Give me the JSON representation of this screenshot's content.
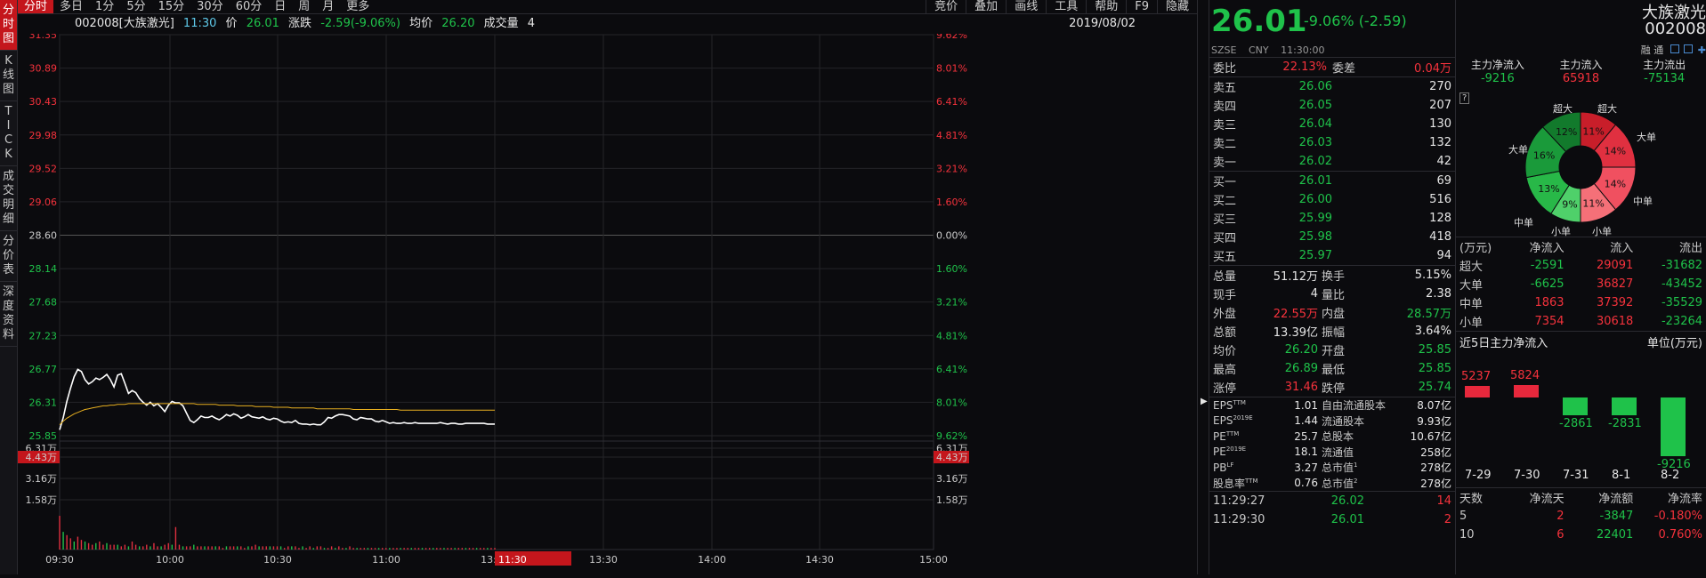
{
  "vtabs": [
    "分时图",
    "K线图",
    "TICK",
    "成交明细",
    "分价表",
    "深度资料"
  ],
  "topbar": {
    "left": [
      "分时",
      "多日",
      "1分",
      "5分",
      "15分",
      "30分",
      "60分",
      "日",
      "周",
      "月",
      "更多"
    ],
    "right": [
      "竞价",
      "叠加",
      "画线",
      "工具",
      "帮助",
      "F9",
      "隐藏"
    ]
  },
  "info": {
    "stock": "002008[大族激光]",
    "time": "11:30",
    "price_label": "价",
    "price": "26.01",
    "chg_label": "涨跌",
    "chg": "-2.59(-9.06%)",
    "avg_label": "均价",
    "avg": "26.20",
    "vol_label": "成交量",
    "vol": "4",
    "date": "2019/08/02"
  },
  "chart_data": {
    "type": "line",
    "title": "",
    "prev_close": 28.6,
    "ylim": [
      25.85,
      31.35
    ],
    "y_ticks_left": [
      "31.35",
      "30.89",
      "30.43",
      "29.98",
      "29.52",
      "29.06",
      "28.60",
      "28.14",
      "27.68",
      "27.23",
      "26.77",
      "26.31",
      "25.85"
    ],
    "y_ticks_right": [
      "9.62%",
      "8.01%",
      "6.41%",
      "4.81%",
      "3.21%",
      "1.60%",
      "0.00%",
      "1.60%",
      "3.21%",
      "4.81%",
      "6.41%",
      "8.01%",
      "9.62%"
    ],
    "x_ticks": [
      "09:30",
      "10:00",
      "10:30",
      "11:00",
      "13:00",
      "13:30",
      "14:00",
      "14:30",
      "15:00"
    ],
    "cursor_time": "11:30",
    "vol_ticks": [
      "6.31万",
      "4.43万",
      "3.16万",
      "1.58万"
    ],
    "vol_cursor": "4.43万",
    "series": [
      {
        "values": [
          25.93,
          26.1,
          26.32,
          26.5,
          26.66,
          26.76,
          26.73,
          26.62,
          26.56,
          26.59,
          26.64,
          26.62,
          26.65,
          26.69,
          26.62,
          26.52,
          26.68,
          26.7,
          26.57,
          26.43,
          26.47,
          26.44,
          26.36,
          26.31,
          26.27,
          26.31,
          26.26,
          26.29,
          26.24,
          26.18,
          26.27,
          26.32,
          26.3,
          26.3,
          26.26,
          26.16,
          26.06,
          26.03,
          26.07,
          26.12,
          26.1,
          26.1,
          26.12,
          26.09,
          26.07,
          26.1,
          26.14,
          26.12,
          26.15,
          26.13,
          26.09,
          26.11,
          26.14,
          26.11,
          26.1,
          26.09,
          26.11,
          26.08,
          26.07,
          26.09,
          26.08,
          26.05,
          26.03,
          26.04,
          26.03,
          26.06,
          26.02,
          26.01,
          26.01,
          26.0,
          26.01,
          26.0,
          26.0,
          26.04,
          26.1,
          26.09,
          26.12,
          26.14,
          26.14,
          26.13,
          26.12,
          26.08,
          26.07,
          26.1,
          26.09,
          26.08,
          26.08,
          26.05,
          26.04,
          26.06,
          26.04,
          26.02,
          26.03,
          26.02,
          26.02,
          26.03,
          26.02,
          26.02,
          26.03,
          26.02,
          26.02,
          26.02,
          26.02,
          26.02,
          26.02,
          26.03,
          26.02,
          26.01,
          26.02,
          26.02,
          26.01,
          26.01,
          26.02,
          26.02,
          26.02,
          26.02,
          26.02,
          26.02,
          26.01,
          26.01,
          26.01
        ]
      },
      {
        "values": [
          26.0,
          26.05,
          26.09,
          26.12,
          26.15,
          26.17,
          26.19,
          26.21,
          26.22,
          26.23,
          26.24,
          26.25,
          26.26,
          26.26,
          26.27,
          26.27,
          26.28,
          26.28,
          26.28,
          26.29,
          26.29,
          26.29,
          26.29,
          26.29,
          26.29,
          26.29,
          26.29,
          26.29,
          26.29,
          26.29,
          26.29,
          26.29,
          26.29,
          26.29,
          26.29,
          26.29,
          26.29,
          26.29,
          26.28,
          26.28,
          26.28,
          26.28,
          26.28,
          26.28,
          26.27,
          26.27,
          26.27,
          26.27,
          26.27,
          26.26,
          26.26,
          26.26,
          26.26,
          26.26,
          26.25,
          26.25,
          26.25,
          26.25,
          26.25,
          26.24,
          26.24,
          26.24,
          26.24,
          26.24,
          26.23,
          26.23,
          26.23,
          26.23,
          26.23,
          26.23,
          26.23,
          26.22,
          26.22,
          26.22,
          26.22,
          26.22,
          26.22,
          26.22,
          26.22,
          26.22,
          26.22,
          26.21,
          26.21,
          26.21,
          26.21,
          26.21,
          26.21,
          26.21,
          26.21,
          26.21,
          26.21,
          26.21,
          26.21,
          26.21,
          26.2,
          26.2,
          26.2,
          26.2,
          26.2,
          26.2,
          26.2,
          26.2,
          26.2,
          26.2,
          26.2,
          26.2,
          26.2,
          26.2,
          26.2,
          26.2,
          26.2,
          26.2,
          26.2,
          26.2,
          26.2,
          26.2,
          26.2,
          26.2,
          26.2,
          26.2,
          26.2
        ]
      }
    ],
    "volume": [
      2.1,
      1.1,
      0.9,
      0.7,
      0.5,
      0.8,
      0.6,
      0.5,
      0.4,
      0.3,
      0.4,
      0.5,
      0.3,
      0.4,
      0.3,
      0.3,
      0.3,
      0.2,
      0.3,
      0.2,
      0.5,
      0.3,
      0.2,
      0.2,
      0.3,
      0.2,
      0.4,
      0.2,
      0.2,
      0.3,
      0.4,
      0.3,
      1.4,
      0.3,
      0.2,
      0.2,
      0.2,
      0.3,
      0.2,
      0.2,
      0.2,
      0.2,
      0.2,
      0.2,
      0.2,
      0.1,
      0.2,
      0.2,
      0.2,
      0.2,
      0.2,
      0.1,
      0.2,
      0.2,
      0.3,
      0.2,
      0.2,
      0.2,
      0.2,
      0.2,
      0.2,
      0.2,
      0.1,
      0.2,
      0.2,
      0.2,
      0.1,
      0.2,
      0.1,
      0.2,
      0.1,
      0.2,
      0.2,
      0.1,
      0.1,
      0.2,
      0.1,
      0.2,
      0.1,
      0.1,
      0.2,
      0.1,
      0.1,
      0.1,
      0.1,
      0.1,
      0.1,
      0.1,
      0.1,
      0.1,
      0.1,
      0.1,
      0.1,
      0.1,
      0.1,
      0.1,
      0.1,
      0.1,
      0.1,
      0.1,
      0.1,
      0.1,
      0.1,
      0.1,
      0.1,
      0.1,
      0.1,
      0.1,
      0.1,
      0.1,
      0.1,
      0.1,
      0.1,
      0.1,
      0.1,
      0.1,
      0.1,
      0.1,
      0.1,
      0.1,
      0.1
    ]
  },
  "quote": {
    "price": "26.01",
    "chg": "-9.06% (-2.59)",
    "name": "大族激光",
    "code": "002008",
    "market": "SZSE",
    "currency": "CNY",
    "time": "11:30:00",
    "icons": "融 通"
  },
  "weibi": {
    "label1": "委比",
    "v1": "22.13%",
    "label2": "委差",
    "v2": "0.04万"
  },
  "asks": [
    {
      "label": "卖五",
      "price": "26.06",
      "vol": "270"
    },
    {
      "label": "卖四",
      "price": "26.05",
      "vol": "207"
    },
    {
      "label": "卖三",
      "price": "26.04",
      "vol": "130"
    },
    {
      "label": "卖二",
      "price": "26.03",
      "vol": "132"
    },
    {
      "label": "卖一",
      "price": "26.02",
      "vol": "42"
    }
  ],
  "bids": [
    {
      "label": "买一",
      "price": "26.01",
      "vol": "69"
    },
    {
      "label": "买二",
      "price": "26.00",
      "vol": "516"
    },
    {
      "label": "买三",
      "price": "25.99",
      "vol": "128"
    },
    {
      "label": "买四",
      "price": "25.98",
      "vol": "418"
    },
    {
      "label": "买五",
      "price": "25.97",
      "vol": "94"
    }
  ],
  "stats": [
    {
      "a": "总量",
      "b": "51.12万",
      "bc": "white",
      "c": "换手",
      "d": "5.15%",
      "dc": "white"
    },
    {
      "a": "现手",
      "b": "4",
      "bc": "white",
      "c": "量比",
      "d": "2.38",
      "dc": "white"
    },
    {
      "a": "外盘",
      "b": "22.55万",
      "bc": "red",
      "c": "内盘",
      "d": "28.57万",
      "dc": "green"
    },
    {
      "a": "总额",
      "b": "13.39亿",
      "bc": "white",
      "c": "振幅",
      "d": "3.64%",
      "dc": "white"
    },
    {
      "a": "均价",
      "b": "26.20",
      "bc": "green",
      "c": "开盘",
      "d": "25.85",
      "dc": "green"
    },
    {
      "a": "最高",
      "b": "26.89",
      "bc": "green",
      "c": "最低",
      "d": "25.85",
      "dc": "green"
    },
    {
      "a": "涨停",
      "b": "31.46",
      "bc": "red",
      "c": "跌停",
      "d": "25.74",
      "dc": "green"
    }
  ],
  "fundamentals": [
    {
      "a": "EPS",
      "sup": "TTM",
      "b": "1.01",
      "c": "自由流通股本",
      "d": "8.07亿"
    },
    {
      "a": "EPS",
      "sup": "2019E",
      "b": "1.44",
      "c": "流通股本",
      "d": "9.93亿"
    },
    {
      "a": "PE",
      "sup": "TTM",
      "b": "25.7",
      "c": "总股本",
      "d": "10.67亿"
    },
    {
      "a": "PE",
      "sup": "2019E",
      "b": "18.1",
      "c": "流通值",
      "d": "258亿"
    },
    {
      "a": "PB",
      "sup": "LF",
      "b": "3.27",
      "c": "总市值",
      "csup": "1",
      "d": "278亿"
    },
    {
      "a": "股息率",
      "sup": "TTM",
      "b": "0.76",
      "c": "总市值",
      "csup": "2",
      "d": "278亿"
    }
  ],
  "ticks": [
    {
      "time": "11:29:27",
      "price": "26.02",
      "vol": "14"
    },
    {
      "time": "11:29:30",
      "price": "26.01",
      "vol": "2"
    }
  ],
  "flows": {
    "h1": "主力净流入",
    "v1": "-9216",
    "h2": "主力流入",
    "v2": "65918",
    "h3": "主力流出",
    "v3": "-75134"
  },
  "donut": {
    "help": "?",
    "labels": [
      "超大",
      "超大",
      "大单",
      "大单",
      "中单",
      "中单",
      "小单",
      "小单"
    ],
    "slices": [
      {
        "pct": 11,
        "label": "11%",
        "color": "#c81e2a"
      },
      {
        "pct": 14,
        "label": "14%",
        "color": "#e03040"
      },
      {
        "pct": 14,
        "label": "14%",
        "color": "#f05060"
      },
      {
        "pct": 11,
        "label": "11%",
        "color": "#f57078"
      },
      {
        "pct": 9,
        "label": "9%",
        "color": "#4fd06a"
      },
      {
        "pct": 13,
        "label": "13%",
        "color": "#28b848"
      },
      {
        "pct": 16,
        "label": "16%",
        "color": "#1a9a3a"
      },
      {
        "pct": 12,
        "label": "12%",
        "color": "#127a2c"
      }
    ]
  },
  "flow_table": {
    "head": [
      "(万元)",
      "净流入",
      "流入",
      "流出"
    ],
    "rows": [
      {
        "c1": "超大",
        "c2": "-2591",
        "c2c": "green",
        "c3": "29091",
        "c4": "-31682"
      },
      {
        "c1": "大单",
        "c2": "-6625",
        "c2c": "green",
        "c3": "36827",
        "c4": "-43452"
      },
      {
        "c1": "中单",
        "c2": "1863",
        "c2c": "red",
        "c3": "37392",
        "c4": "-35529"
      },
      {
        "c1": "小单",
        "c2": "7354",
        "c2c": "red",
        "c3": "30618",
        "c4": "-23264"
      }
    ]
  },
  "five_day": {
    "title": "近5日主力净流入",
    "unit": "单位(万元)",
    "bars": [
      {
        "date": "7-29",
        "value": 5237,
        "label": "5237"
      },
      {
        "date": "7-30",
        "value": 5824,
        "label": "5824"
      },
      {
        "date": "7-31",
        "value": -2861,
        "label": "-2861"
      },
      {
        "date": "8-1",
        "value": -2831,
        "label": "-2831"
      },
      {
        "date": "8-2",
        "value": -9216,
        "label": "-9216"
      }
    ]
  },
  "days_table": {
    "head": [
      "天数",
      "净流天",
      "净流额",
      "净流率"
    ],
    "rows": [
      {
        "c1": "5",
        "c2": "2",
        "c3": "-3847",
        "c4": "-0.180%"
      },
      {
        "c1": "10",
        "c2": "6",
        "c3": "22401",
        "c4": "0.760%"
      }
    ]
  }
}
